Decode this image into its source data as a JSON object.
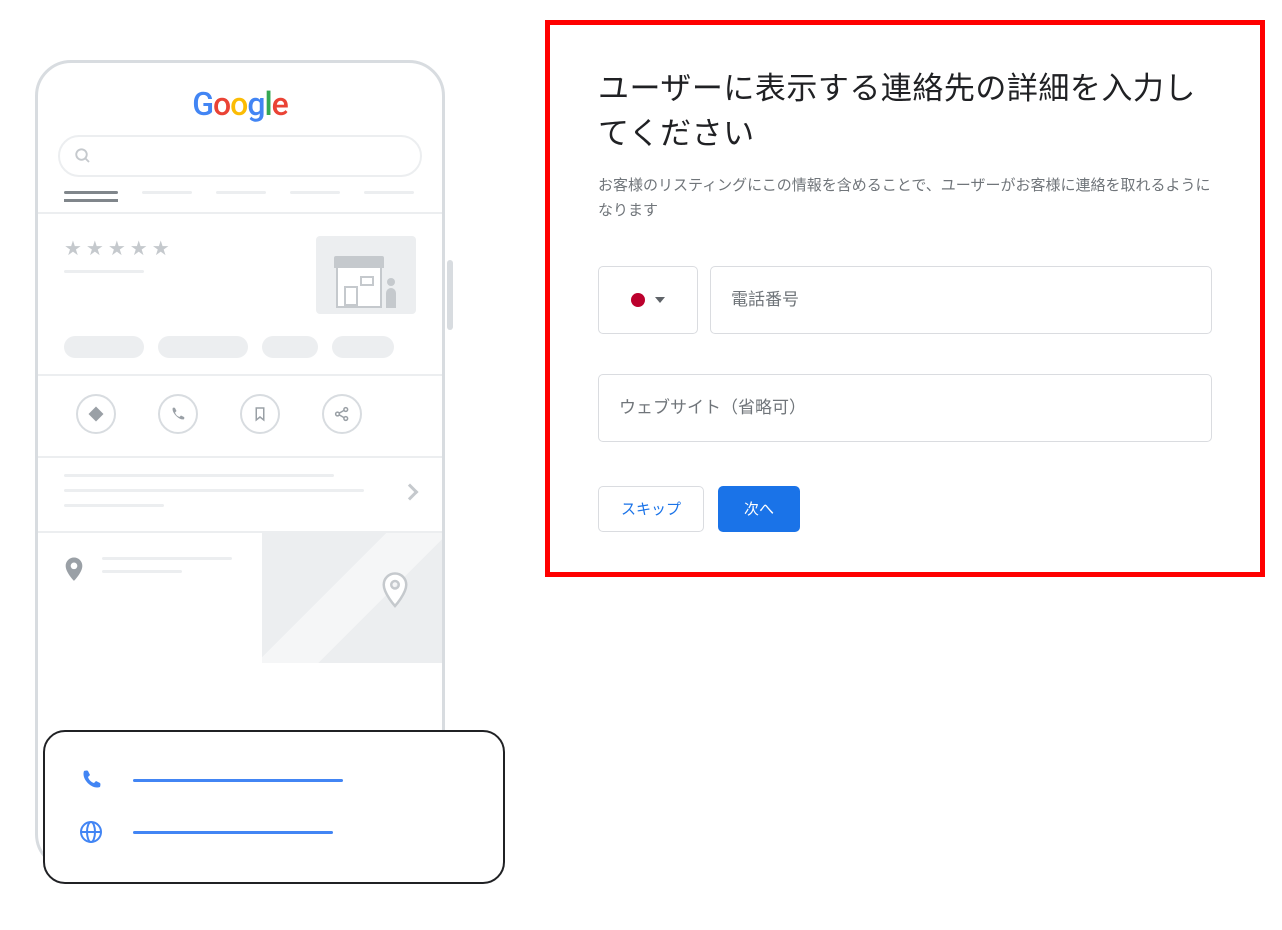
{
  "form": {
    "title": "ユーザーに表示する連絡先の詳細を入力してください",
    "subtitle": "お客様のリスティングにこの情報を含めることで、ユーザーがお客様に連絡を取れるようになります",
    "country_flag": "japan",
    "phone_placeholder": "電話番号",
    "phone_value": "",
    "website_placeholder": "ウェブサイト（省略可）",
    "website_value": "",
    "skip_label": "スキップ",
    "next_label": "次へ"
  },
  "mockup": {
    "logo": "Google"
  }
}
